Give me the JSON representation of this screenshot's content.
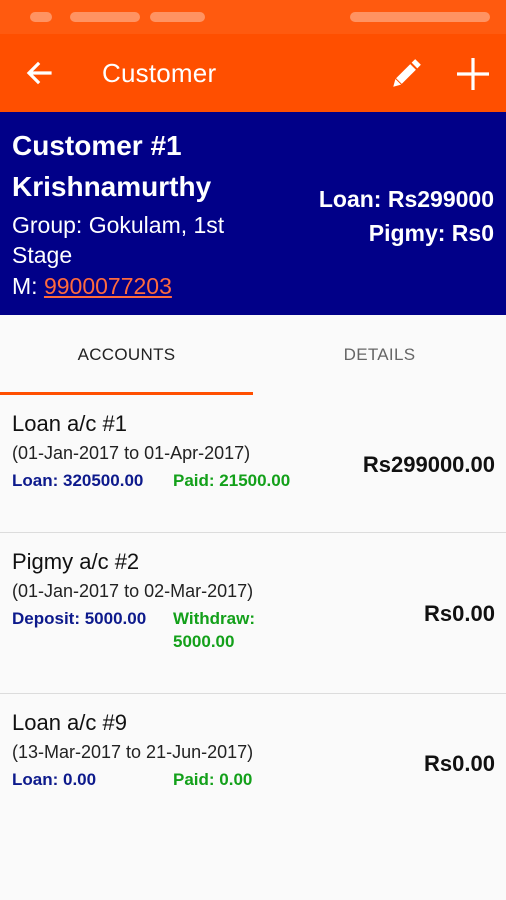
{
  "app_bar": {
    "title": "Customer",
    "back_icon": "arrow-left-icon",
    "edit_icon": "pencil-icon",
    "add_icon": "plus-icon",
    "color": "#ff4f00"
  },
  "customer": {
    "number": "Customer #1",
    "name": "Krishnamurthy",
    "group": "Group: Gokulam, 1st Stage",
    "mobile_label": "M: ",
    "mobile": "9900077203",
    "loan_total": "Loan: Rs299000",
    "pigmy_total": "Pigmy: Rs0",
    "header_color": "#010088"
  },
  "tabs": [
    {
      "label": "ACCOUNTS",
      "selected": true
    },
    {
      "label": "DETAILS",
      "selected": false
    }
  ],
  "accounts": [
    {
      "title": "Loan a/c #1",
      "dates": "(01-Jan-2017 to 01-Apr-2017)",
      "k1": "Loan: 320500.00",
      "k2": "Paid: 21500.00",
      "amount": "Rs299000.00"
    },
    {
      "title": "Pigmy a/c #2",
      "dates": "(01-Jan-2017 to 02-Mar-2017)",
      "k1": "Deposit: 5000.00",
      "k2": "Withdraw: 5000.00",
      "amount": "Rs0.00"
    },
    {
      "title": "Loan a/c #9",
      "dates": "(13-Mar-2017 to 21-Jun-2017)",
      "k1": "Loan: 0.00",
      "k2": "Paid: 0.00",
      "amount": "Rs0.00"
    }
  ]
}
